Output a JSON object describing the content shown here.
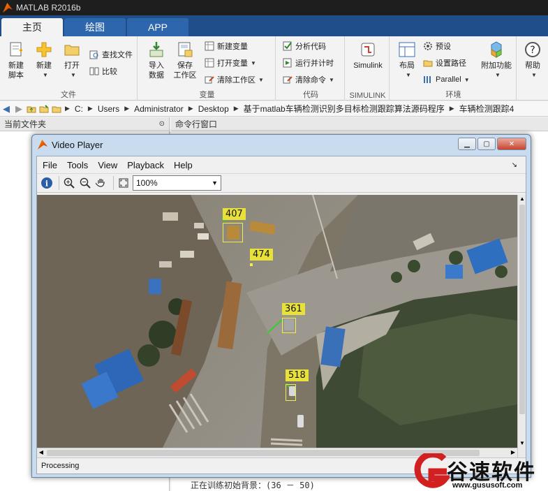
{
  "app": {
    "title": "MATLAB R2016b"
  },
  "tabs": [
    {
      "label": "主页"
    },
    {
      "label": "绘图"
    },
    {
      "label": "APP"
    }
  ],
  "ribbon": {
    "file_group": {
      "label": "文件",
      "new_script": "新建\n脚本",
      "new": "新建",
      "open": "打开",
      "find_files": "查找文件",
      "compare": "比较"
    },
    "variable_group": {
      "label": "变量",
      "import": "导入\n数据",
      "save_workspace": "保存\n工作区",
      "new_variable": "新建变量",
      "open_variable": "打开变量",
      "clear_workspace": "清除工作区"
    },
    "code_group": {
      "label": "代码",
      "analyze": "分析代码",
      "run_time": "运行并计时",
      "clear_commands": "清除命令"
    },
    "simulink_group": {
      "label": "SIMULINK",
      "simulink": "Simulink"
    },
    "env_group": {
      "label": "环境",
      "layout": "布局",
      "preferences": "预设",
      "set_path": "设置路径",
      "parallel": "Parallel",
      "addons": "附加功能"
    },
    "resources_group": {
      "help": "帮助"
    }
  },
  "address": {
    "crumbs": [
      "C:",
      "Users",
      "Administrator",
      "Desktop",
      "基于matlab车辆检测识别多目标检测跟踪算法源码程序",
      "车辆检测跟踪4"
    ]
  },
  "panels": {
    "current_folder": "当前文件夹",
    "command_window": "命令行窗口",
    "command_line": "正在训练初始背景：(36 － 50)"
  },
  "video_player": {
    "title": "Video Player",
    "menu": [
      "File",
      "Tools",
      "View",
      "Playback",
      "Help"
    ],
    "zoom": "100%",
    "status": "Processing",
    "tracks": [
      {
        "id": "407"
      },
      {
        "id": "474"
      },
      {
        "id": "361"
      },
      {
        "id": "518"
      }
    ]
  },
  "watermark": {
    "text": "谷速软件",
    "url": "www.gususoft.com"
  },
  "colors": {
    "tab_bar": "#1f4e8a",
    "track_label": "#e8e13a",
    "track_path": "#2fd02f"
  }
}
